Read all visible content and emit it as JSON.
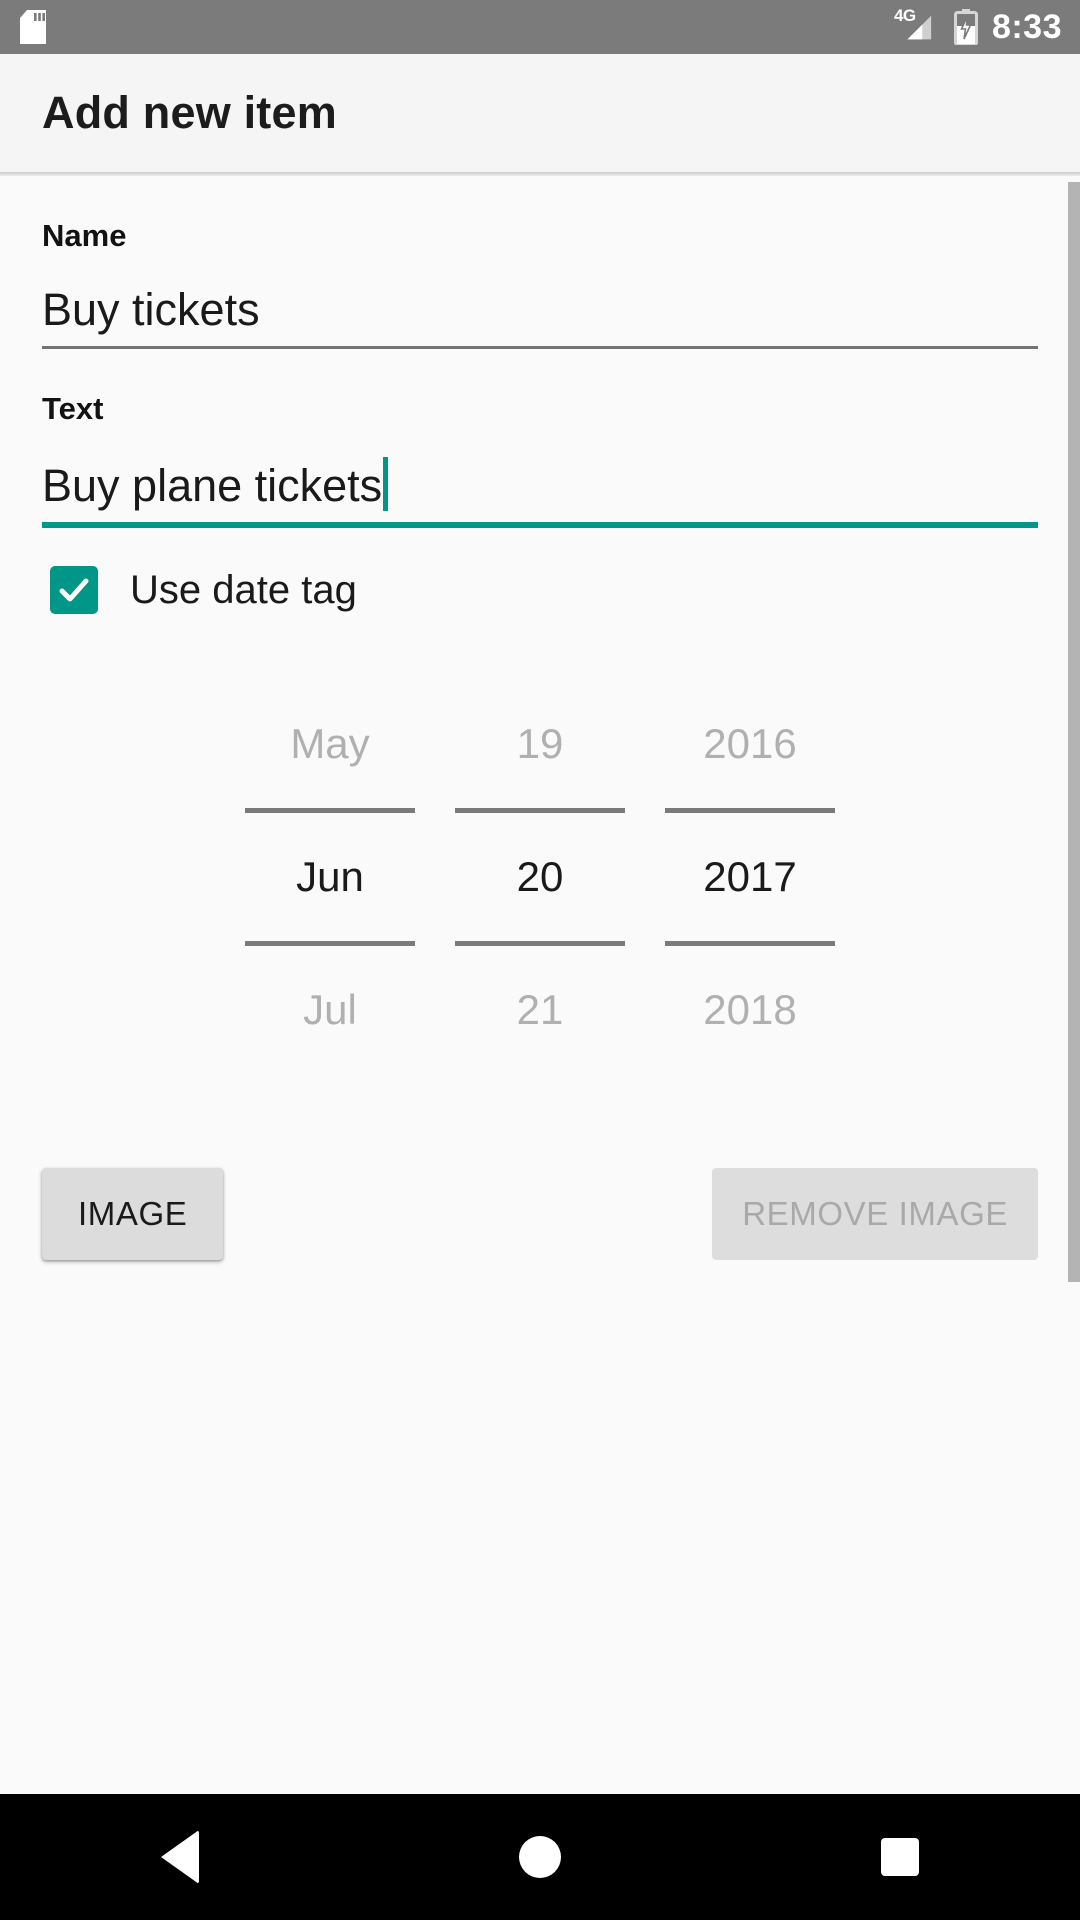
{
  "status_bar": {
    "sd_icon": "sd-card-icon",
    "network_label": "4G",
    "signal_icon": "signal-bars-icon",
    "battery_icon": "battery-charging-icon",
    "time": "8:33",
    "background_color": "#7b7b7b"
  },
  "app_bar": {
    "title": "Add new item",
    "background_color": "#f5f5f5"
  },
  "form": {
    "name_field": {
      "label": "Name",
      "value": "Buy tickets",
      "placeholder": "Name",
      "focused": false,
      "underline_color": "#737373"
    },
    "text_field": {
      "label": "Text",
      "value": "Buy plane tickets",
      "placeholder": "Text",
      "focused": true,
      "underline_color": "#009688"
    },
    "date_tag_checkbox": {
      "label": "Use date tag",
      "checked": true,
      "accent_color": "#009688",
      "check_icon": "checkmark-icon"
    }
  },
  "date_picker": {
    "month": {
      "previous": "May",
      "selected": "Jun",
      "next": "Jul"
    },
    "day": {
      "previous": "19",
      "selected": "20",
      "next": "21"
    },
    "year": {
      "previous": "2016",
      "selected": "2017",
      "next": "2018"
    }
  },
  "buttons": {
    "image": {
      "label": "IMAGE",
      "enabled": true
    },
    "remove_image": {
      "label": "REMOVE IMAGE",
      "enabled": false
    }
  },
  "nav_bar": {
    "back": "back-triangle-icon",
    "home": "home-circle-icon",
    "recents": "recents-square-icon",
    "background_color": "#000000"
  },
  "theme": {
    "accent": "#009688",
    "background": "#fafafa",
    "scrollbar": "#b4b4b4"
  }
}
